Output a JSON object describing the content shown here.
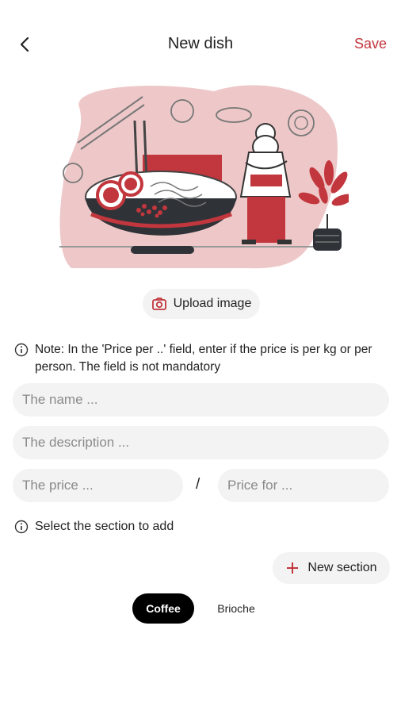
{
  "header": {
    "title": "New dish",
    "save_label": "Save",
    "back_icon": "chevron-left-icon"
  },
  "illustration": {
    "semantic": "chef with ramen bowl illustration"
  },
  "upload": {
    "label": "Upload image",
    "icon": "camera-icon"
  },
  "note": {
    "text": "Note: In the 'Price per ..' field, enter if the price is per kg or per person. The field is not mandatory",
    "icon": "info-icon"
  },
  "form": {
    "name_placeholder": "The name ...",
    "description_placeholder": "The description ...",
    "price_placeholder": "The price ...",
    "price_for_placeholder": "Price for ...",
    "slash": "/"
  },
  "section": {
    "select_text": "Select the section to add",
    "new_section_label": "New section",
    "chips": [
      {
        "label": "Coffee",
        "selected": true
      },
      {
        "label": "Brioche",
        "selected": false
      }
    ]
  },
  "colors": {
    "accent": "#c2363d",
    "chip_selected_bg": "#000000",
    "field_bg": "#f3f3f3",
    "illustration_pink": "#eec8c8"
  }
}
